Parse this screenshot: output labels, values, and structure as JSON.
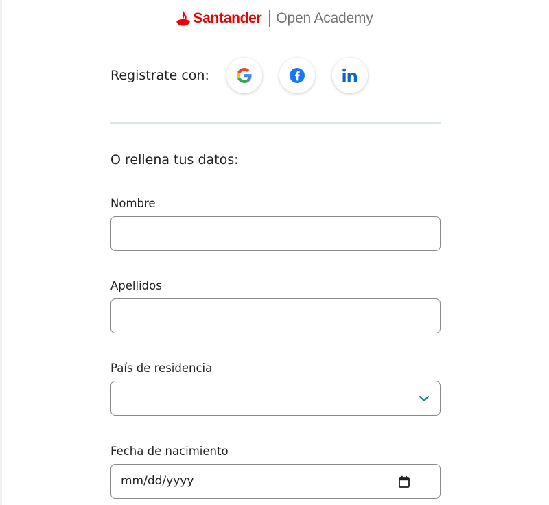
{
  "header": {
    "brand": "Santander",
    "product": "Open Academy"
  },
  "social": {
    "label": "Registrate con:",
    "providers": [
      {
        "name": "Google",
        "icon": "google-icon"
      },
      {
        "name": "Facebook",
        "icon": "facebook-icon"
      },
      {
        "name": "LinkedIn",
        "icon": "linkedin-icon"
      }
    ]
  },
  "form": {
    "section_title": "O rellena tus datos:",
    "nombre": {
      "label": "Nombre",
      "value": ""
    },
    "apellidos": {
      "label": "Apellidos",
      "value": ""
    },
    "pais": {
      "label": "País de residencia",
      "value": "",
      "icon": "chevron-down-icon"
    },
    "fecha": {
      "label": "Fecha de nacimiento",
      "placeholder": "mm/dd/yyyy",
      "icon": "calendar-icon"
    }
  },
  "colors": {
    "brand_red": "#ec0000",
    "chevron": "#137e84",
    "facebook": "#1877f2",
    "linkedin": "#0a66c2",
    "divider": "#d9e6ee"
  }
}
